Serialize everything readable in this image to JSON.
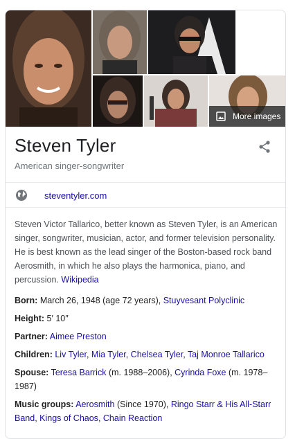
{
  "photos": {
    "more_images_label": "More images"
  },
  "header": {
    "title": "Steven Tyler",
    "subtitle": "American singer-songwriter"
  },
  "website": {
    "label": "steventyler.com"
  },
  "description": {
    "text": "Steven Victor Tallarico, better known as Steven Tyler, is an American singer, songwriter, musician, actor, and former television personality. He is best known as the lead singer of the Boston-based rock band Aerosmith, in which he also plays the harmonica, piano, and percussion.",
    "source_link": "Wikipedia"
  },
  "facts": {
    "born": {
      "label": "Born:",
      "value": "March 26, 1948 (age 72 years),",
      "link": "Stuyvesant Polyclinic"
    },
    "height": {
      "label": "Height:",
      "value": "5′ 10″"
    },
    "partner": {
      "label": "Partner:",
      "link": "Aimee Preston"
    },
    "children": {
      "label": "Children:",
      "links": [
        "Liv Tyler",
        "Mia Tyler",
        "Chelsea Tyler",
        "Taj Monroe Tallarico"
      ]
    },
    "spouse": {
      "label": "Spouse:",
      "link1": "Teresa Barrick",
      "text1": "(m. 1988–2006),",
      "link2": "Cyrinda Foxe",
      "text2": "(m. 1978–1987)"
    },
    "music_groups": {
      "label": "Music groups:",
      "link1": "Aerosmith",
      "text1": "(Since 1970),",
      "link2": "Ringo Starr & His All-Starr Band",
      "link3": "Kings of Chaos",
      "link4": "Chain Reaction"
    }
  },
  "colors": {
    "link": "#1a0dab",
    "title": "#202124",
    "muted": "#70757a",
    "body_text": "#4d5156"
  }
}
